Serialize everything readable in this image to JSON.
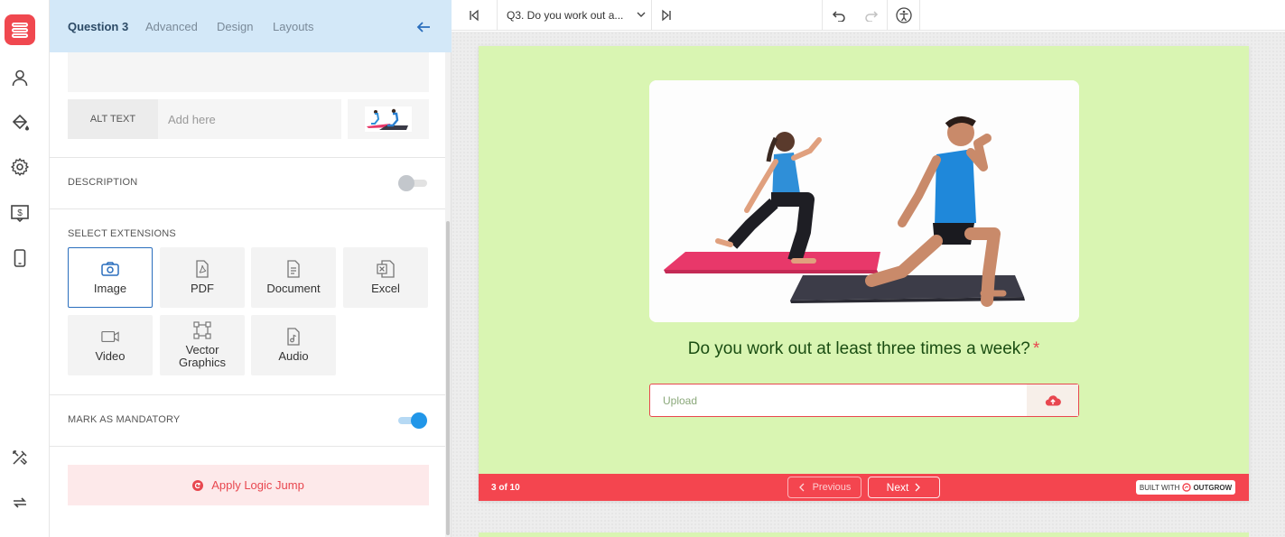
{
  "colors": {
    "brand": "#f0484f",
    "accent_blue": "#2a6ebd",
    "card_bg": "#d9f5b2",
    "footer_bg": "#f4454f",
    "tab_bar_bg": "#d3e8f8"
  },
  "rail": {
    "icons": [
      "logo-icon",
      "user-icon",
      "paint-bucket-icon",
      "gear-icon",
      "pricing-icon",
      "mobile-icon",
      "tools-icon",
      "sync-icon"
    ]
  },
  "panel": {
    "tabs": [
      {
        "label": "Question 3",
        "active": true
      },
      {
        "label": "Advanced",
        "active": false
      },
      {
        "label": "Design",
        "active": false
      },
      {
        "label": "Layouts",
        "active": false
      }
    ],
    "alt_text": {
      "label": "ALT TEXT",
      "placeholder": "Add here"
    },
    "description": {
      "label": "DESCRIPTION",
      "enabled": false
    },
    "extensions": {
      "label": "SELECT EXTENSIONS",
      "items": [
        {
          "label": "Image",
          "icon": "camera-icon",
          "selected": true
        },
        {
          "label": "PDF",
          "icon": "pdf-file-icon",
          "selected": false
        },
        {
          "label": "Document",
          "icon": "document-icon",
          "selected": false
        },
        {
          "label": "Excel",
          "icon": "excel-icon",
          "selected": false
        },
        {
          "label": "Video",
          "icon": "video-icon",
          "selected": false
        },
        {
          "label": "Vector Graphics",
          "icon": "vector-icon",
          "selected": false
        },
        {
          "label": "Audio",
          "icon": "audio-file-icon",
          "selected": false
        }
      ]
    },
    "mandatory": {
      "label": "MARK AS MANDATORY",
      "enabled": true
    },
    "logic_jump": {
      "label": "Apply Logic Jump"
    }
  },
  "toolbar": {
    "question_select": "Q3. Do you work out a...",
    "icons": [
      "first-question-icon",
      "last-question-icon",
      "undo-icon",
      "redo-icon",
      "accessibility-icon"
    ]
  },
  "card": {
    "question": "Do you work out at least three times a week?",
    "required_mark": "*",
    "upload_placeholder": "Upload",
    "progress": "3 of 10",
    "prev_label": "Previous",
    "next_label": "Next",
    "built_with": "BUILT WITH",
    "built_brand": "OUTGROW"
  }
}
